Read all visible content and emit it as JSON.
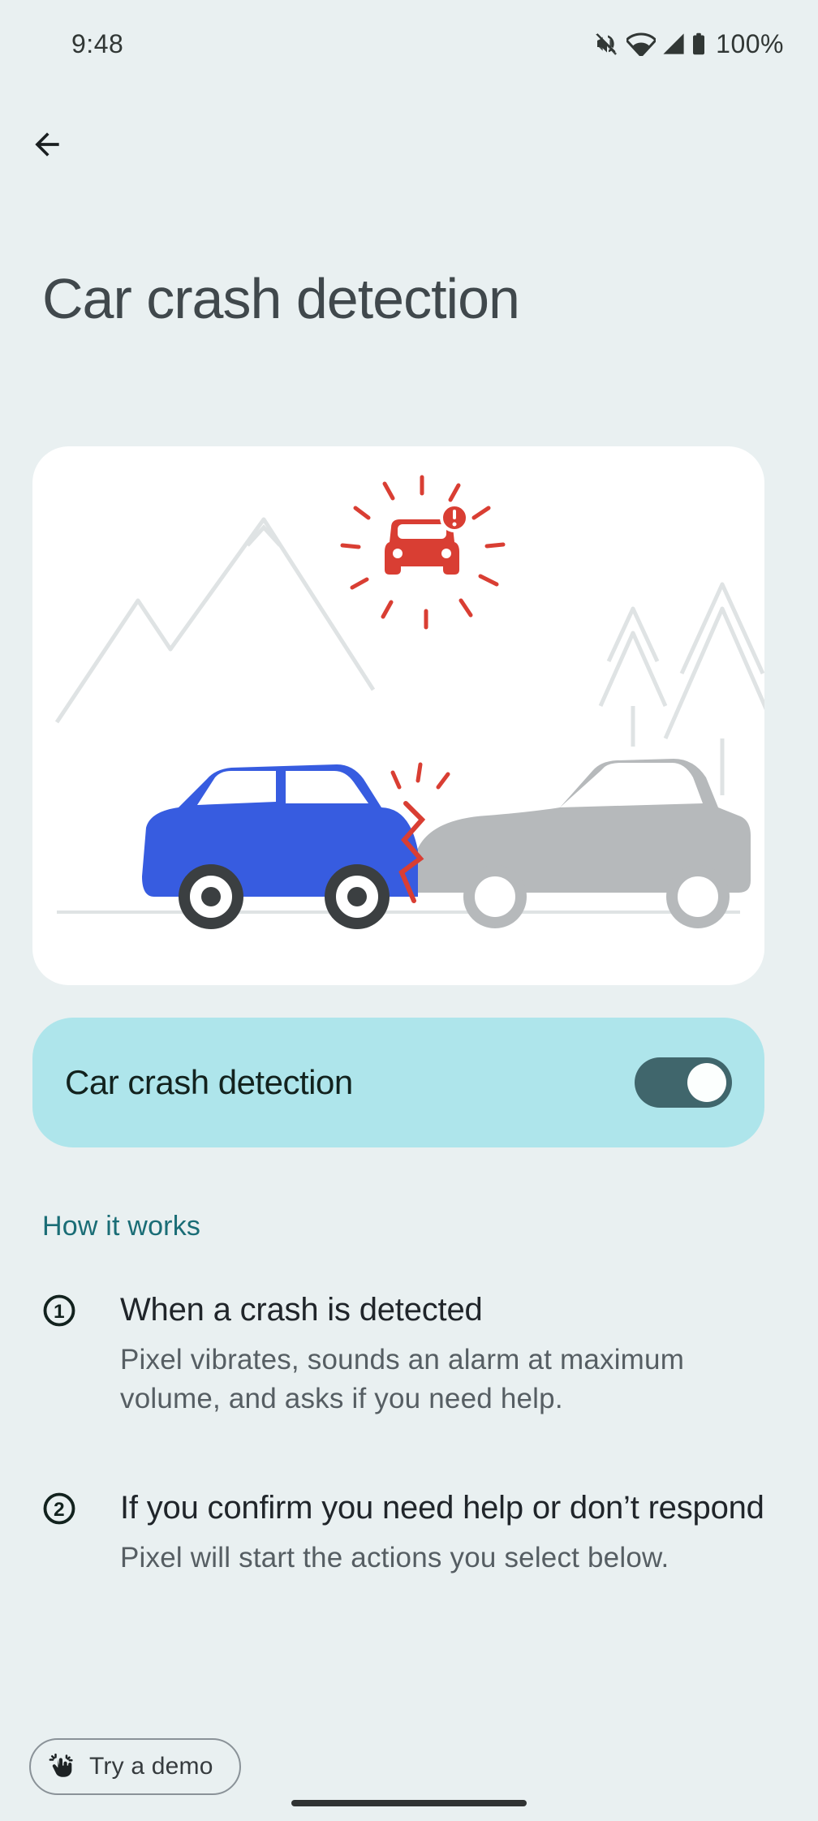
{
  "status": {
    "time": "9:48",
    "battery": "100%"
  },
  "title": "Car crash detection",
  "toggle": {
    "label": "Car crash detection",
    "on": true
  },
  "how_it_works": {
    "heading": "How it works",
    "steps": [
      {
        "title": "When a crash is detected",
        "desc": "Pixel vibrates, sounds an alarm at maximum volume, and asks if you need help."
      },
      {
        "title": "If you confirm you need help or don’t respond",
        "desc": "Pixel will start the actions you select below."
      }
    ]
  },
  "demo": {
    "label": "Try a demo"
  }
}
